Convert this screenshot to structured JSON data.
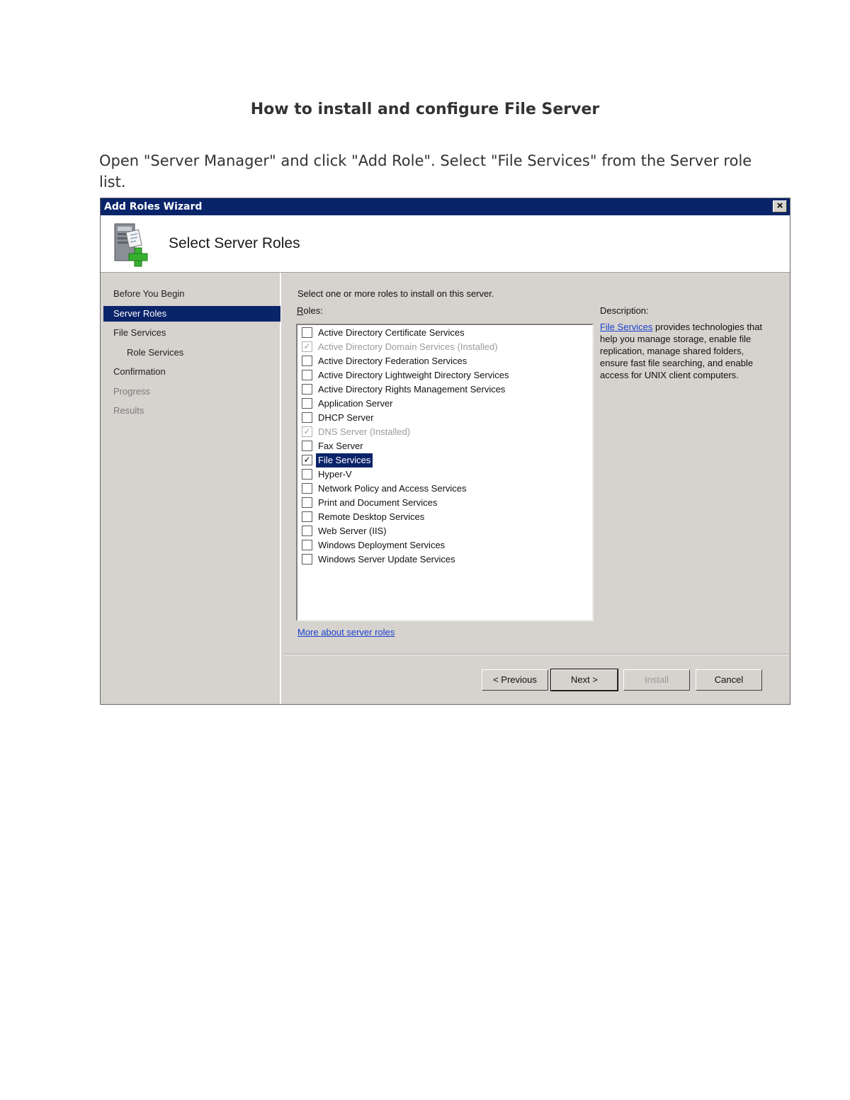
{
  "doc": {
    "title": "How to install and configure File Server",
    "paragraph": "Open \"Server Manager\" and click \"Add Role\". Select \"File Services\" from the Server role list."
  },
  "wizard": {
    "window_title": "Add Roles Wizard",
    "header_title": "Select Server Roles",
    "nav": [
      {
        "label": "Before You Begin",
        "state": "normal"
      },
      {
        "label": "Server Roles",
        "state": "active"
      },
      {
        "label": "File Services",
        "state": "normal"
      },
      {
        "label": "Role Services",
        "state": "sub"
      },
      {
        "label": "Confirmation",
        "state": "normal"
      },
      {
        "label": "Progress",
        "state": "disabled"
      },
      {
        "label": "Results",
        "state": "disabled"
      }
    ],
    "instruction": "Select one or more roles to install on this server.",
    "roles_label": "Roles:",
    "roles": [
      {
        "label": "Active Directory Certificate Services",
        "checked": false,
        "installed": false
      },
      {
        "label": "Active Directory Domain Services  (Installed)",
        "checked": true,
        "installed": true
      },
      {
        "label": "Active Directory Federation Services",
        "checked": false,
        "installed": false
      },
      {
        "label": "Active Directory Lightweight Directory Services",
        "checked": false,
        "installed": false
      },
      {
        "label": "Active Directory Rights Management Services",
        "checked": false,
        "installed": false
      },
      {
        "label": "Application Server",
        "checked": false,
        "installed": false
      },
      {
        "label": "DHCP Server",
        "checked": false,
        "installed": false
      },
      {
        "label": "DNS Server  (Installed)",
        "checked": true,
        "installed": true
      },
      {
        "label": "Fax Server",
        "checked": false,
        "installed": false
      },
      {
        "label": "File Services",
        "checked": true,
        "installed": false,
        "selected": true
      },
      {
        "label": "Hyper-V",
        "checked": false,
        "installed": false
      },
      {
        "label": "Network Policy and Access Services",
        "checked": false,
        "installed": false
      },
      {
        "label": "Print and Document Services",
        "checked": false,
        "installed": false
      },
      {
        "label": "Remote Desktop Services",
        "checked": false,
        "installed": false
      },
      {
        "label": "Web Server (IIS)",
        "checked": false,
        "installed": false
      },
      {
        "label": "Windows Deployment Services",
        "checked": false,
        "installed": false
      },
      {
        "label": "Windows Server Update Services",
        "checked": false,
        "installed": false
      }
    ],
    "description_label": "Description:",
    "description_link": "File Services",
    "description_text": " provides technologies that help you manage storage, enable file replication, manage shared folders, ensure fast file searching, and enable access for UNIX client computers.",
    "more_link": "More about server roles",
    "buttons": {
      "previous": "< Previous",
      "next": "Next >",
      "install": "Install",
      "cancel": "Cancel"
    },
    "colors": {
      "titlebar": "#0a246a",
      "selection": "#0a246a",
      "link": "#1a3fd0",
      "dialog_bg": "#d6d3ce"
    }
  }
}
